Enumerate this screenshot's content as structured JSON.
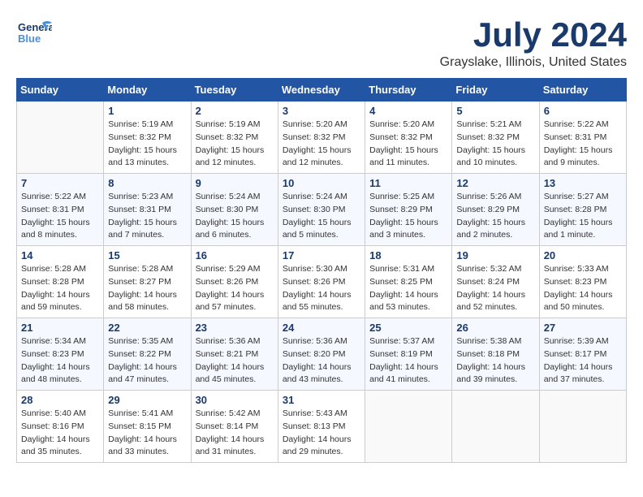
{
  "logo": {
    "general": "General",
    "blue": "Blue"
  },
  "header": {
    "month": "July 2024",
    "location": "Grayslake, Illinois, United States"
  },
  "days_of_week": [
    "Sunday",
    "Monday",
    "Tuesday",
    "Wednesday",
    "Thursday",
    "Friday",
    "Saturday"
  ],
  "weeks": [
    [
      {
        "day": "",
        "info": ""
      },
      {
        "day": "1",
        "info": "Sunrise: 5:19 AM\nSunset: 8:32 PM\nDaylight: 15 hours\nand 13 minutes."
      },
      {
        "day": "2",
        "info": "Sunrise: 5:19 AM\nSunset: 8:32 PM\nDaylight: 15 hours\nand 12 minutes."
      },
      {
        "day": "3",
        "info": "Sunrise: 5:20 AM\nSunset: 8:32 PM\nDaylight: 15 hours\nand 12 minutes."
      },
      {
        "day": "4",
        "info": "Sunrise: 5:20 AM\nSunset: 8:32 PM\nDaylight: 15 hours\nand 11 minutes."
      },
      {
        "day": "5",
        "info": "Sunrise: 5:21 AM\nSunset: 8:32 PM\nDaylight: 15 hours\nand 10 minutes."
      },
      {
        "day": "6",
        "info": "Sunrise: 5:22 AM\nSunset: 8:31 PM\nDaylight: 15 hours\nand 9 minutes."
      }
    ],
    [
      {
        "day": "7",
        "info": "Sunrise: 5:22 AM\nSunset: 8:31 PM\nDaylight: 15 hours\nand 8 minutes."
      },
      {
        "day": "8",
        "info": "Sunrise: 5:23 AM\nSunset: 8:31 PM\nDaylight: 15 hours\nand 7 minutes."
      },
      {
        "day": "9",
        "info": "Sunrise: 5:24 AM\nSunset: 8:30 PM\nDaylight: 15 hours\nand 6 minutes."
      },
      {
        "day": "10",
        "info": "Sunrise: 5:24 AM\nSunset: 8:30 PM\nDaylight: 15 hours\nand 5 minutes."
      },
      {
        "day": "11",
        "info": "Sunrise: 5:25 AM\nSunset: 8:29 PM\nDaylight: 15 hours\nand 3 minutes."
      },
      {
        "day": "12",
        "info": "Sunrise: 5:26 AM\nSunset: 8:29 PM\nDaylight: 15 hours\nand 2 minutes."
      },
      {
        "day": "13",
        "info": "Sunrise: 5:27 AM\nSunset: 8:28 PM\nDaylight: 15 hours\nand 1 minute."
      }
    ],
    [
      {
        "day": "14",
        "info": "Sunrise: 5:28 AM\nSunset: 8:28 PM\nDaylight: 14 hours\nand 59 minutes."
      },
      {
        "day": "15",
        "info": "Sunrise: 5:28 AM\nSunset: 8:27 PM\nDaylight: 14 hours\nand 58 minutes."
      },
      {
        "day": "16",
        "info": "Sunrise: 5:29 AM\nSunset: 8:26 PM\nDaylight: 14 hours\nand 57 minutes."
      },
      {
        "day": "17",
        "info": "Sunrise: 5:30 AM\nSunset: 8:26 PM\nDaylight: 14 hours\nand 55 minutes."
      },
      {
        "day": "18",
        "info": "Sunrise: 5:31 AM\nSunset: 8:25 PM\nDaylight: 14 hours\nand 53 minutes."
      },
      {
        "day": "19",
        "info": "Sunrise: 5:32 AM\nSunset: 8:24 PM\nDaylight: 14 hours\nand 52 minutes."
      },
      {
        "day": "20",
        "info": "Sunrise: 5:33 AM\nSunset: 8:23 PM\nDaylight: 14 hours\nand 50 minutes."
      }
    ],
    [
      {
        "day": "21",
        "info": "Sunrise: 5:34 AM\nSunset: 8:23 PM\nDaylight: 14 hours\nand 48 minutes."
      },
      {
        "day": "22",
        "info": "Sunrise: 5:35 AM\nSunset: 8:22 PM\nDaylight: 14 hours\nand 47 minutes."
      },
      {
        "day": "23",
        "info": "Sunrise: 5:36 AM\nSunset: 8:21 PM\nDaylight: 14 hours\nand 45 minutes."
      },
      {
        "day": "24",
        "info": "Sunrise: 5:36 AM\nSunset: 8:20 PM\nDaylight: 14 hours\nand 43 minutes."
      },
      {
        "day": "25",
        "info": "Sunrise: 5:37 AM\nSunset: 8:19 PM\nDaylight: 14 hours\nand 41 minutes."
      },
      {
        "day": "26",
        "info": "Sunrise: 5:38 AM\nSunset: 8:18 PM\nDaylight: 14 hours\nand 39 minutes."
      },
      {
        "day": "27",
        "info": "Sunrise: 5:39 AM\nSunset: 8:17 PM\nDaylight: 14 hours\nand 37 minutes."
      }
    ],
    [
      {
        "day": "28",
        "info": "Sunrise: 5:40 AM\nSunset: 8:16 PM\nDaylight: 14 hours\nand 35 minutes."
      },
      {
        "day": "29",
        "info": "Sunrise: 5:41 AM\nSunset: 8:15 PM\nDaylight: 14 hours\nand 33 minutes."
      },
      {
        "day": "30",
        "info": "Sunrise: 5:42 AM\nSunset: 8:14 PM\nDaylight: 14 hours\nand 31 minutes."
      },
      {
        "day": "31",
        "info": "Sunrise: 5:43 AM\nSunset: 8:13 PM\nDaylight: 14 hours\nand 29 minutes."
      },
      {
        "day": "",
        "info": ""
      },
      {
        "day": "",
        "info": ""
      },
      {
        "day": "",
        "info": ""
      }
    ]
  ]
}
